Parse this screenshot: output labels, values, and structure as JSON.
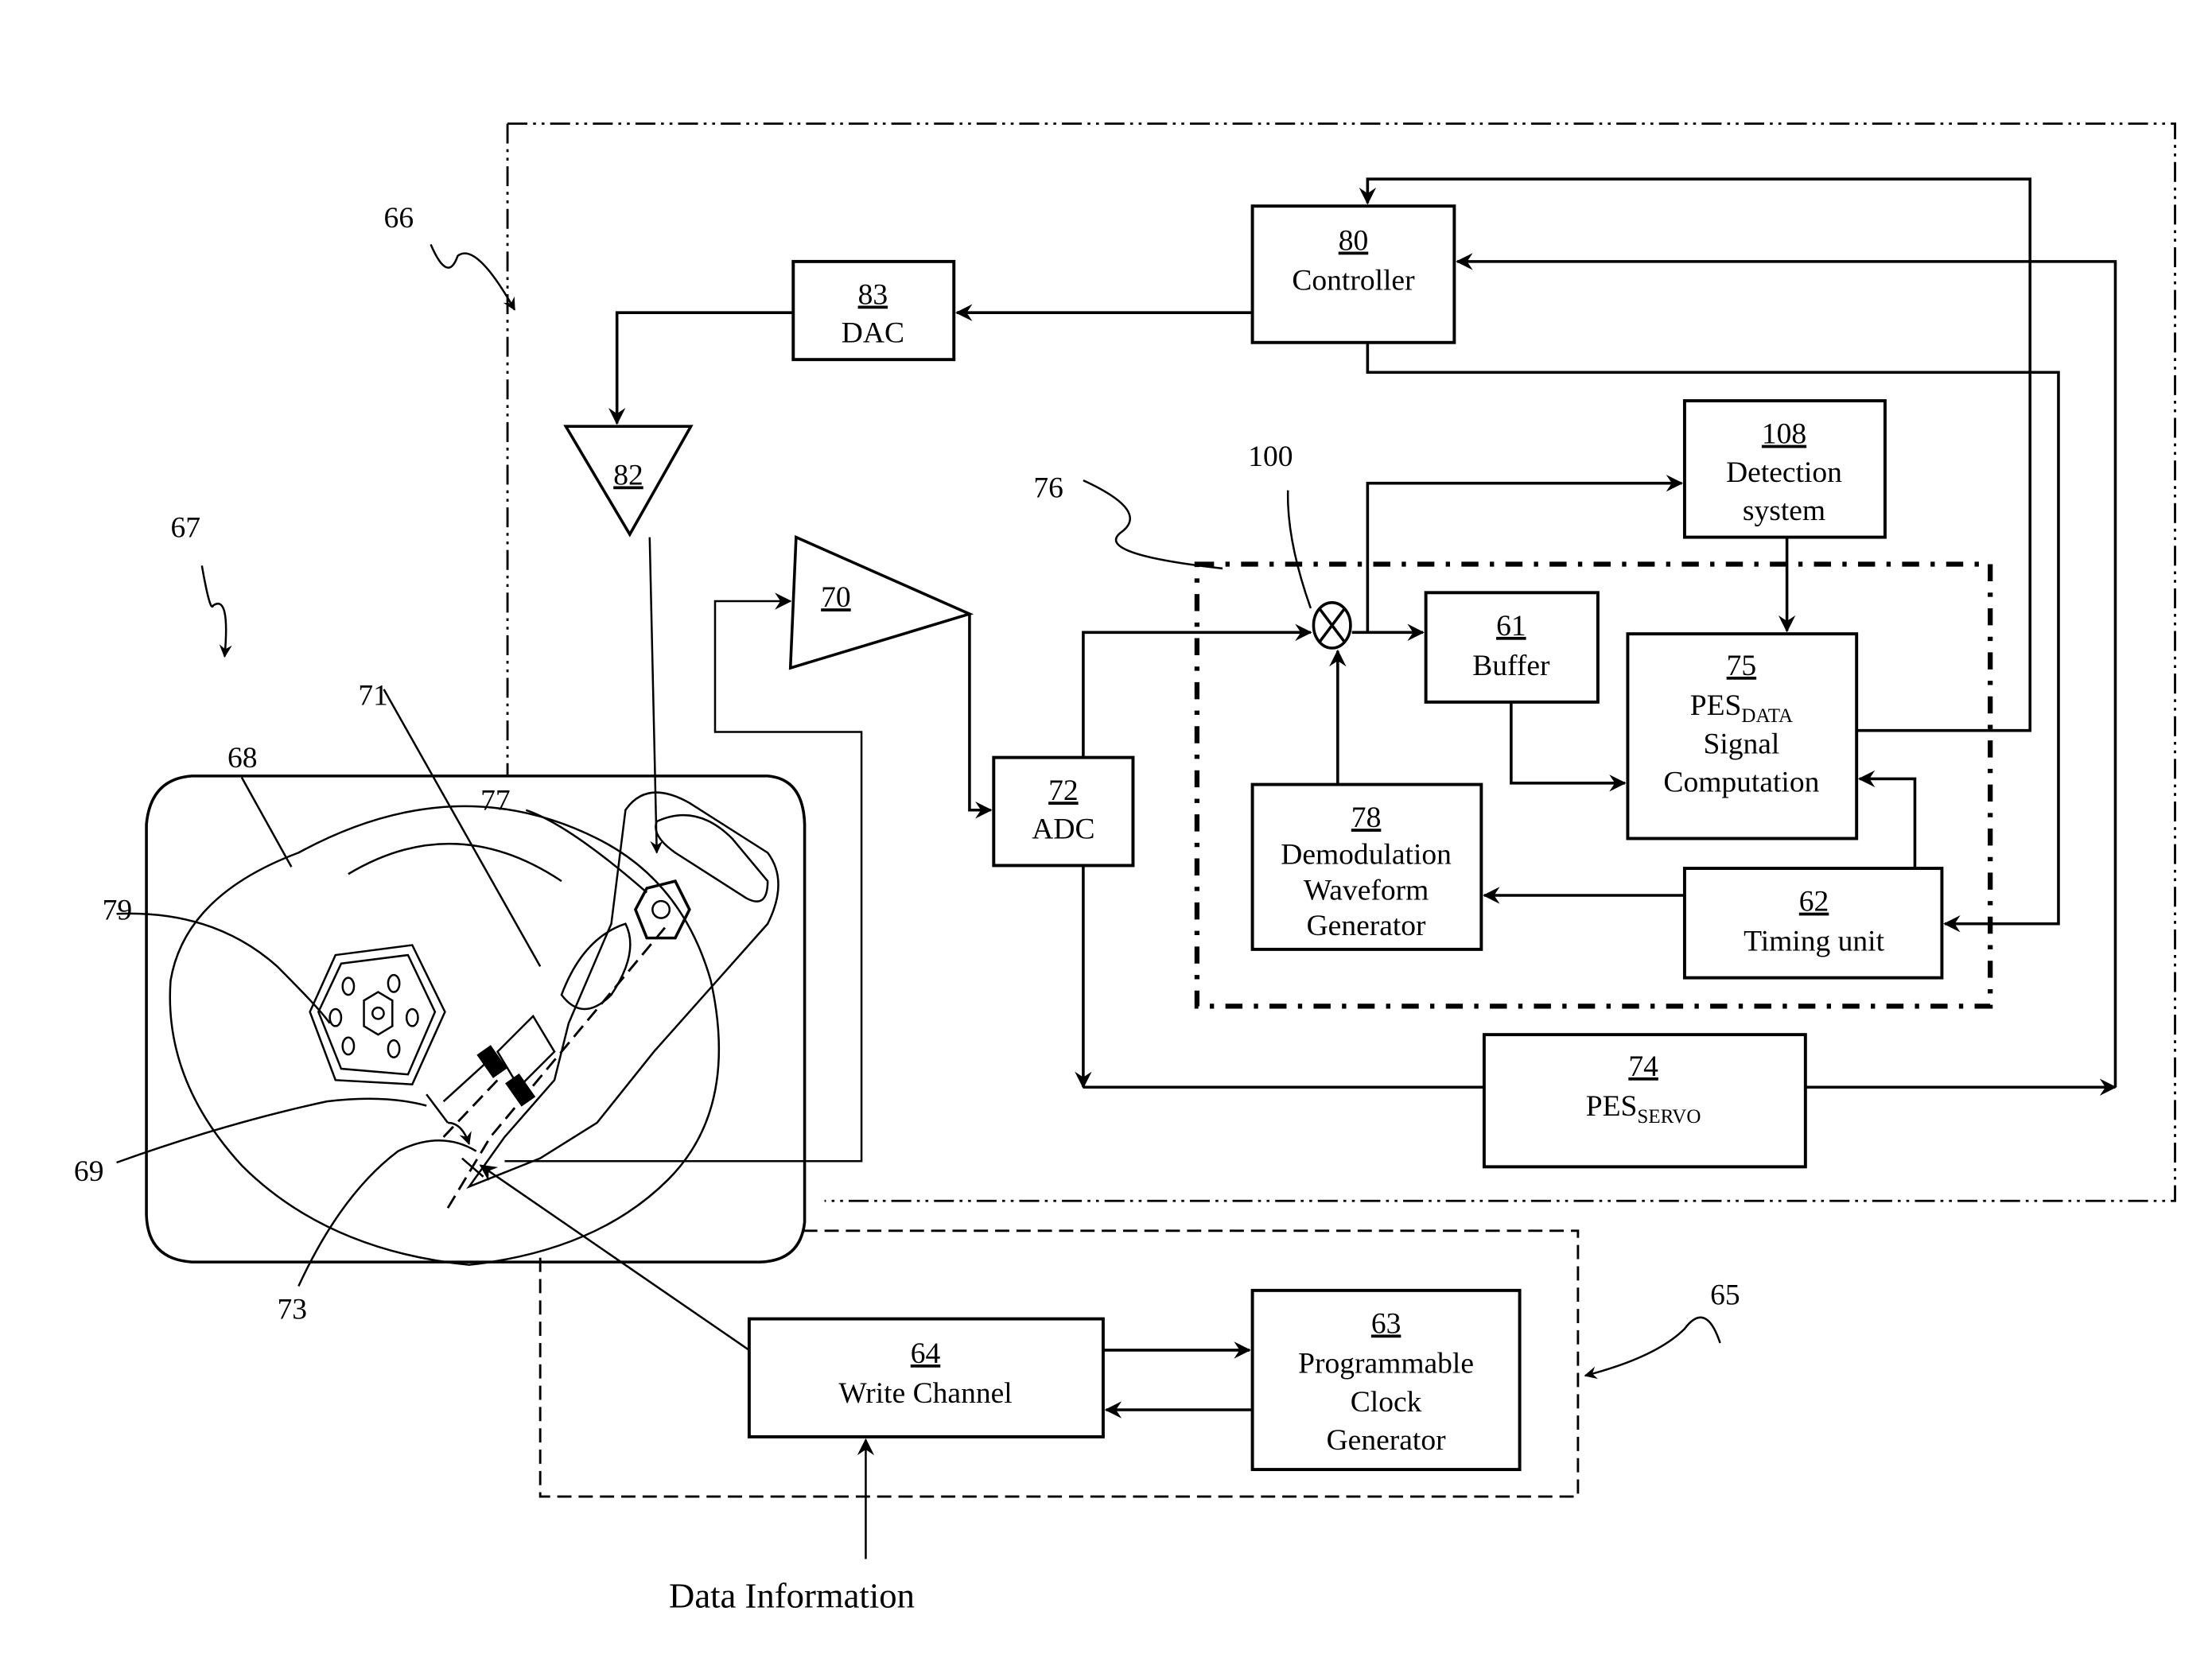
{
  "figure": {
    "blocks": {
      "controller": {
        "num": "80",
        "label": "Controller"
      },
      "dac": {
        "num": "83",
        "label": "DAC"
      },
      "amp82": {
        "num": "82"
      },
      "amp70": {
        "num": "70"
      },
      "adc": {
        "num": "72",
        "label": "ADC"
      },
      "detection": {
        "num": "108",
        "line1": "Detection",
        "line2": "system"
      },
      "buffer": {
        "num": "61",
        "label": "Buffer"
      },
      "pes_data": {
        "num": "75",
        "main": "PES",
        "subscript": "DATA",
        "line2": "Signal",
        "line3": "Computation"
      },
      "demod": {
        "num": "78",
        "line1": "Demodulation",
        "line2": "Waveform",
        "line3": "Generator"
      },
      "timing": {
        "num": "62",
        "label": "Timing unit"
      },
      "pes_servo": {
        "num": "74",
        "main": "PES",
        "subscript": "SERVO"
      },
      "write_channel": {
        "num": "64",
        "label": "Write Channel"
      },
      "clock_gen": {
        "num": "63",
        "line1": "Programmable",
        "line2": "Clock",
        "line3": "Generator"
      }
    },
    "reference_labels": {
      "r66": "66",
      "r67": "67",
      "r76": "76",
      "r100": "100",
      "r71": "71",
      "r68": "68",
      "r77": "77",
      "r79": "79",
      "r69": "69",
      "r73": "73",
      "r65": "65"
    },
    "input_label": "Data Information"
  }
}
